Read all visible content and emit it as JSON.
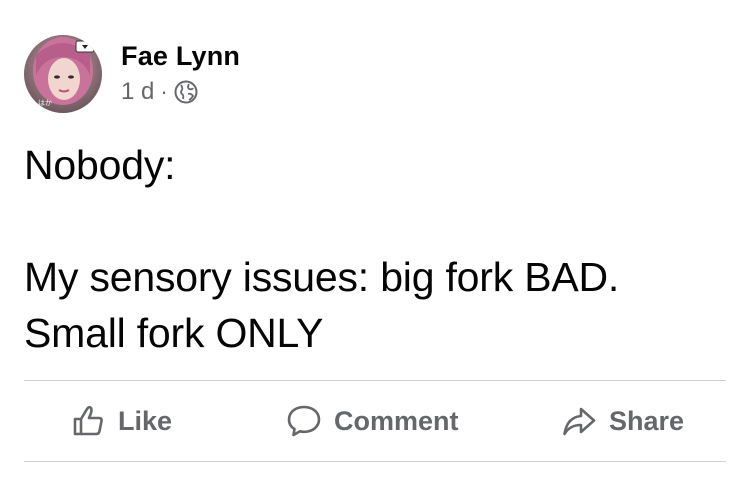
{
  "post": {
    "author": "Fae Lynn",
    "timestamp": "1 d",
    "separator": "·",
    "audience_icon": "globe-icon",
    "text_lines": [
      "Nobody:",
      "",
      "My sensory issues: big fork BAD.",
      "Small fork ONLY"
    ]
  },
  "actions": {
    "like_label": "Like",
    "comment_label": "Comment",
    "share_label": "Share"
  },
  "colors": {
    "text_primary": "#050505",
    "text_secondary": "#65676b",
    "divider": "#ced0d4"
  }
}
